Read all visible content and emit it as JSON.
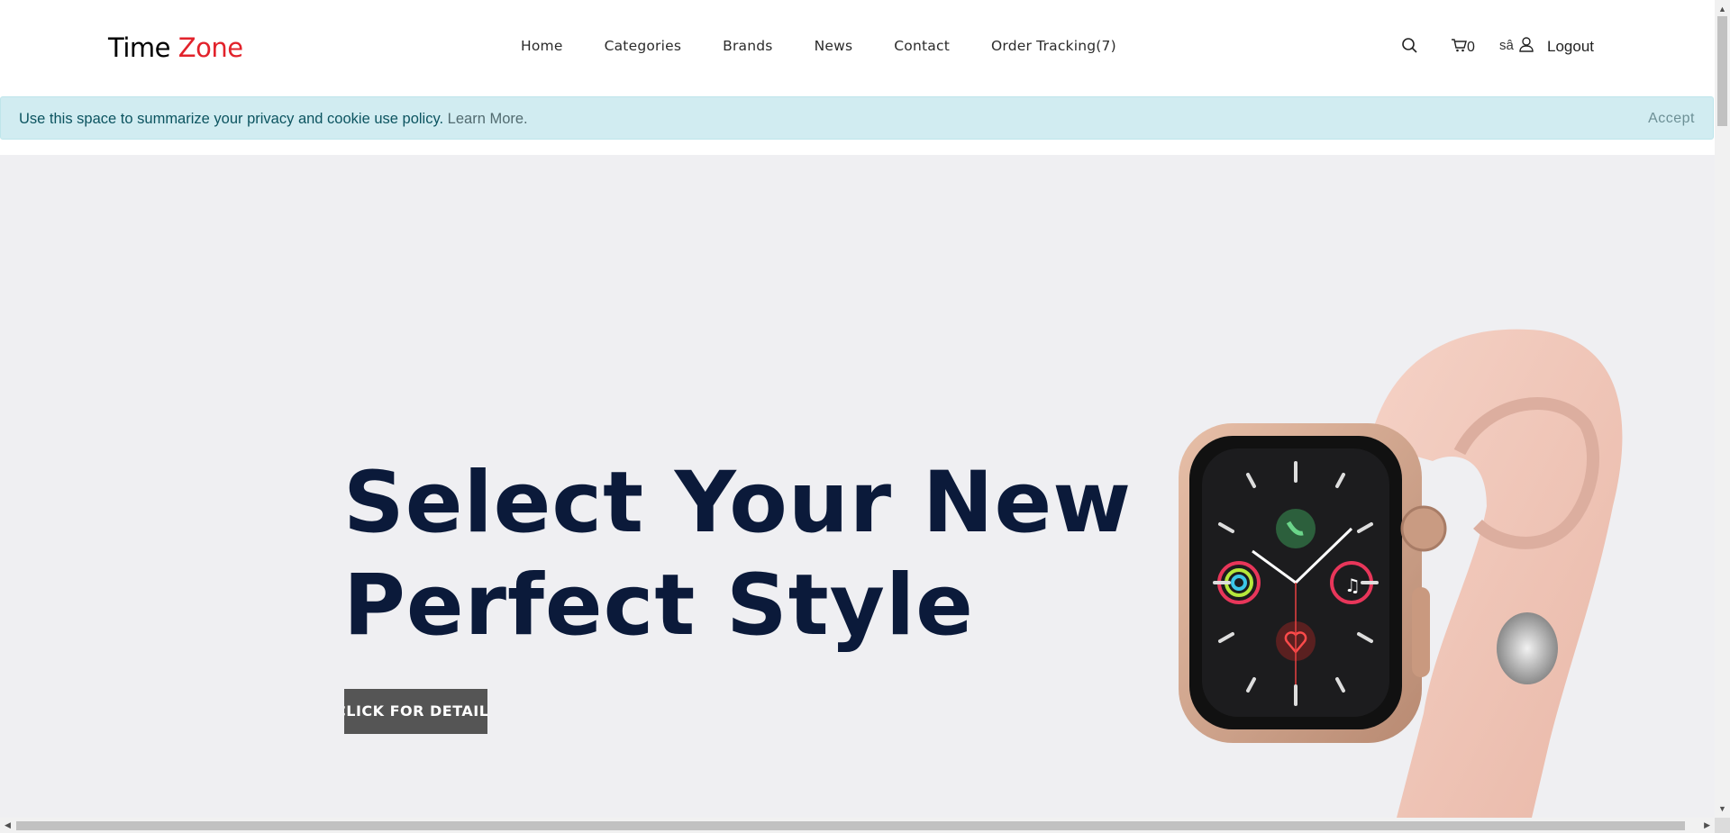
{
  "logo": {
    "part1": "Time",
    "part2": "Zone"
  },
  "nav": {
    "items": [
      "Home",
      "Categories",
      "Brands",
      "News",
      "Contact",
      "Order Tracking(7)"
    ]
  },
  "header": {
    "search_icon": "search-icon",
    "cart_icon": "cart-icon",
    "cart_count": "0",
    "username": "sâ",
    "user_icon": "user-icon",
    "logout": "Logout"
  },
  "cookie": {
    "text": "Use this space to summarize your privacy and cookie use policy.",
    "link": "Learn More.",
    "accept": "Accept"
  },
  "hero": {
    "title_line1": "Select Your New",
    "title_line2": "Perfect Style",
    "button": "CLICK FOR DETAIL"
  },
  "colors": {
    "brand_red": "#e2222b",
    "hero_bg": "#efeff2",
    "title": "#0b1a3a",
    "cookie_bg": "#d1ecf1"
  }
}
